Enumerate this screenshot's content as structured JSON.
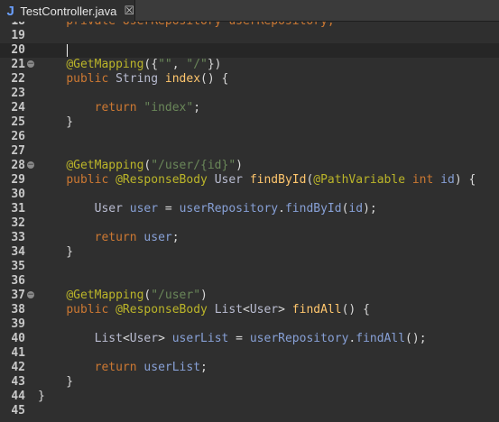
{
  "tab": {
    "icon": "J",
    "icon_name": "java-file-icon",
    "label": "TestController.java",
    "close_glyph": "☒"
  },
  "editor": {
    "lines": [
      {
        "n": "18",
        "fold": false,
        "tokens": [
          {
            "t": "    private UserRepository userRepository;",
            "c": "kw"
          }
        ]
      },
      {
        "n": "19",
        "fold": false,
        "tokens": []
      },
      {
        "n": "20",
        "fold": false,
        "current": true,
        "tokens": []
      },
      {
        "n": "21",
        "fold": true,
        "tokens": [
          {
            "t": "    ",
            "c": "pl"
          },
          {
            "t": "@GetMapping",
            "c": "ann"
          },
          {
            "t": "({",
            "c": "pl"
          },
          {
            "t": "\"\"",
            "c": "str"
          },
          {
            "t": ", ",
            "c": "pl"
          },
          {
            "t": "\"/\"",
            "c": "str"
          },
          {
            "t": "})",
            "c": "pl"
          }
        ]
      },
      {
        "n": "22",
        "fold": false,
        "tokens": [
          {
            "t": "    ",
            "c": "pl"
          },
          {
            "t": "public",
            "c": "kw"
          },
          {
            "t": " ",
            "c": "pl"
          },
          {
            "t": "String",
            "c": "ty"
          },
          {
            "t": " ",
            "c": "pl"
          },
          {
            "t": "index",
            "c": "fn"
          },
          {
            "t": "() {",
            "c": "pl"
          }
        ]
      },
      {
        "n": "23",
        "fold": false,
        "tokens": []
      },
      {
        "n": "24",
        "fold": false,
        "tokens": [
          {
            "t": "        ",
            "c": "pl"
          },
          {
            "t": "return",
            "c": "kw"
          },
          {
            "t": " ",
            "c": "pl"
          },
          {
            "t": "\"index\"",
            "c": "str"
          },
          {
            "t": ";",
            "c": "pl"
          }
        ]
      },
      {
        "n": "25",
        "fold": false,
        "tokens": [
          {
            "t": "    }",
            "c": "pl"
          }
        ]
      },
      {
        "n": "26",
        "fold": false,
        "tokens": []
      },
      {
        "n": "27",
        "fold": false,
        "tokens": []
      },
      {
        "n": "28",
        "fold": true,
        "tokens": [
          {
            "t": "    ",
            "c": "pl"
          },
          {
            "t": "@GetMapping",
            "c": "ann"
          },
          {
            "t": "(",
            "c": "pl"
          },
          {
            "t": "\"/user/{id}\"",
            "c": "str"
          },
          {
            "t": ")",
            "c": "pl"
          }
        ]
      },
      {
        "n": "29",
        "fold": false,
        "tokens": [
          {
            "t": "    ",
            "c": "pl"
          },
          {
            "t": "public",
            "c": "kw"
          },
          {
            "t": " ",
            "c": "pl"
          },
          {
            "t": "@ResponseBody",
            "c": "ann"
          },
          {
            "t": " ",
            "c": "pl"
          },
          {
            "t": "User",
            "c": "ty"
          },
          {
            "t": " ",
            "c": "pl"
          },
          {
            "t": "findById",
            "c": "fn"
          },
          {
            "t": "(",
            "c": "pl"
          },
          {
            "t": "@PathVariable",
            "c": "ann"
          },
          {
            "t": " ",
            "c": "pl"
          },
          {
            "t": "int",
            "c": "kw"
          },
          {
            "t": " ",
            "c": "pl"
          },
          {
            "t": "id",
            "c": "lnk"
          },
          {
            "t": ") {",
            "c": "pl"
          }
        ]
      },
      {
        "n": "30",
        "fold": false,
        "tokens": []
      },
      {
        "n": "31",
        "fold": false,
        "tokens": [
          {
            "t": "        ",
            "c": "pl"
          },
          {
            "t": "User",
            "c": "ty"
          },
          {
            "t": " ",
            "c": "pl"
          },
          {
            "t": "user",
            "c": "lnk"
          },
          {
            "t": " = ",
            "c": "pl"
          },
          {
            "t": "userRepository",
            "c": "lnk"
          },
          {
            "t": ".",
            "c": "pl"
          },
          {
            "t": "findById",
            "c": "lnk"
          },
          {
            "t": "(",
            "c": "pl"
          },
          {
            "t": "id",
            "c": "lnk"
          },
          {
            "t": ");",
            "c": "pl"
          }
        ]
      },
      {
        "n": "32",
        "fold": false,
        "tokens": []
      },
      {
        "n": "33",
        "fold": false,
        "tokens": [
          {
            "t": "        ",
            "c": "pl"
          },
          {
            "t": "return",
            "c": "kw"
          },
          {
            "t": " ",
            "c": "pl"
          },
          {
            "t": "user",
            "c": "lnk"
          },
          {
            "t": ";",
            "c": "pl"
          }
        ]
      },
      {
        "n": "34",
        "fold": false,
        "tokens": [
          {
            "t": "    }",
            "c": "pl"
          }
        ]
      },
      {
        "n": "35",
        "fold": false,
        "tokens": []
      },
      {
        "n": "36",
        "fold": false,
        "tokens": []
      },
      {
        "n": "37",
        "fold": true,
        "tokens": [
          {
            "t": "    ",
            "c": "pl"
          },
          {
            "t": "@GetMapping",
            "c": "ann"
          },
          {
            "t": "(",
            "c": "pl"
          },
          {
            "t": "\"/user\"",
            "c": "str"
          },
          {
            "t": ")",
            "c": "pl"
          }
        ]
      },
      {
        "n": "38",
        "fold": false,
        "tokens": [
          {
            "t": "    ",
            "c": "pl"
          },
          {
            "t": "public",
            "c": "kw"
          },
          {
            "t": " ",
            "c": "pl"
          },
          {
            "t": "@ResponseBody",
            "c": "ann"
          },
          {
            "t": " ",
            "c": "pl"
          },
          {
            "t": "List",
            "c": "ty"
          },
          {
            "t": "<",
            "c": "pl"
          },
          {
            "t": "User",
            "c": "ty"
          },
          {
            "t": "> ",
            "c": "pl"
          },
          {
            "t": "findAll",
            "c": "fn"
          },
          {
            "t": "() {",
            "c": "pl"
          }
        ]
      },
      {
        "n": "39",
        "fold": false,
        "tokens": []
      },
      {
        "n": "40",
        "fold": false,
        "tokens": [
          {
            "t": "        ",
            "c": "pl"
          },
          {
            "t": "List",
            "c": "ty"
          },
          {
            "t": "<",
            "c": "pl"
          },
          {
            "t": "User",
            "c": "ty"
          },
          {
            "t": "> ",
            "c": "pl"
          },
          {
            "t": "userList",
            "c": "lnk"
          },
          {
            "t": " = ",
            "c": "pl"
          },
          {
            "t": "userRepository",
            "c": "lnk"
          },
          {
            "t": ".",
            "c": "pl"
          },
          {
            "t": "findAll",
            "c": "lnk"
          },
          {
            "t": "();",
            "c": "pl"
          }
        ]
      },
      {
        "n": "41",
        "fold": false,
        "tokens": []
      },
      {
        "n": "42",
        "fold": false,
        "tokens": [
          {
            "t": "        ",
            "c": "pl"
          },
          {
            "t": "return",
            "c": "kw"
          },
          {
            "t": " ",
            "c": "pl"
          },
          {
            "t": "userList",
            "c": "lnk"
          },
          {
            "t": ";",
            "c": "pl"
          }
        ]
      },
      {
        "n": "43",
        "fold": false,
        "tokens": [
          {
            "t": "    }",
            "c": "pl"
          }
        ]
      },
      {
        "n": "44",
        "fold": false,
        "tokens": [
          {
            "t": "}",
            "c": "pl"
          }
        ]
      },
      {
        "n": "45",
        "fold": false,
        "tokens": []
      }
    ]
  },
  "colors": {
    "background": "#2f2f2f",
    "keyword": "#cc7832",
    "annotation": "#bbb529",
    "string": "#6a8759",
    "method": "#ffc66d"
  }
}
